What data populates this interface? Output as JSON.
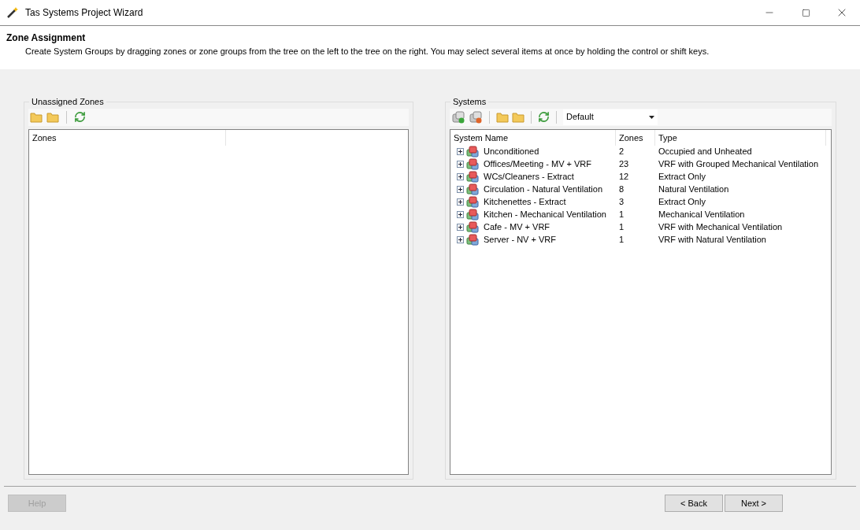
{
  "window": {
    "title": "Tas Systems Project Wizard"
  },
  "header": {
    "title": "Zone Assignment",
    "description": "Create System Groups by dragging zones or zone groups from the tree on the left to the tree on the right.  You may select several items at once by holding the control or shift keys."
  },
  "unassigned": {
    "title": "Unassigned Zones",
    "columns": [
      "Zones"
    ]
  },
  "systems": {
    "title": "Systems",
    "view": "Default",
    "columns": [
      "System Name",
      "Zones",
      "Type"
    ],
    "rows": [
      {
        "name": "Unconditioned",
        "zones": "2",
        "type": "Occupied and Unheated"
      },
      {
        "name": "Offices/Meeting - MV + VRF",
        "zones": "23",
        "type": "VRF with Grouped Mechanical Ventilation"
      },
      {
        "name": "WCs/Cleaners - Extract",
        "zones": "12",
        "type": "Extract Only"
      },
      {
        "name": "Circulation - Natural Ventilation",
        "zones": "8",
        "type": "Natural Ventilation"
      },
      {
        "name": "Kitchenettes - Extract",
        "zones": "3",
        "type": "Extract Only"
      },
      {
        "name": "Kitchen - Mechanical Ventilation",
        "zones": "1",
        "type": "Mechanical Ventilation"
      },
      {
        "name": "Cafe - MV + VRF",
        "zones": "1",
        "type": "VRF with Mechanical Ventilation"
      },
      {
        "name": "Server - NV + VRF",
        "zones": "1",
        "type": "VRF with Natural Ventilation"
      }
    ]
  },
  "buttons": [
    {
      "label": "Help",
      "disabled": true
    },
    {
      "label": "< Back",
      "disabled": false
    },
    {
      "label": "Next >",
      "disabled": false
    }
  ]
}
